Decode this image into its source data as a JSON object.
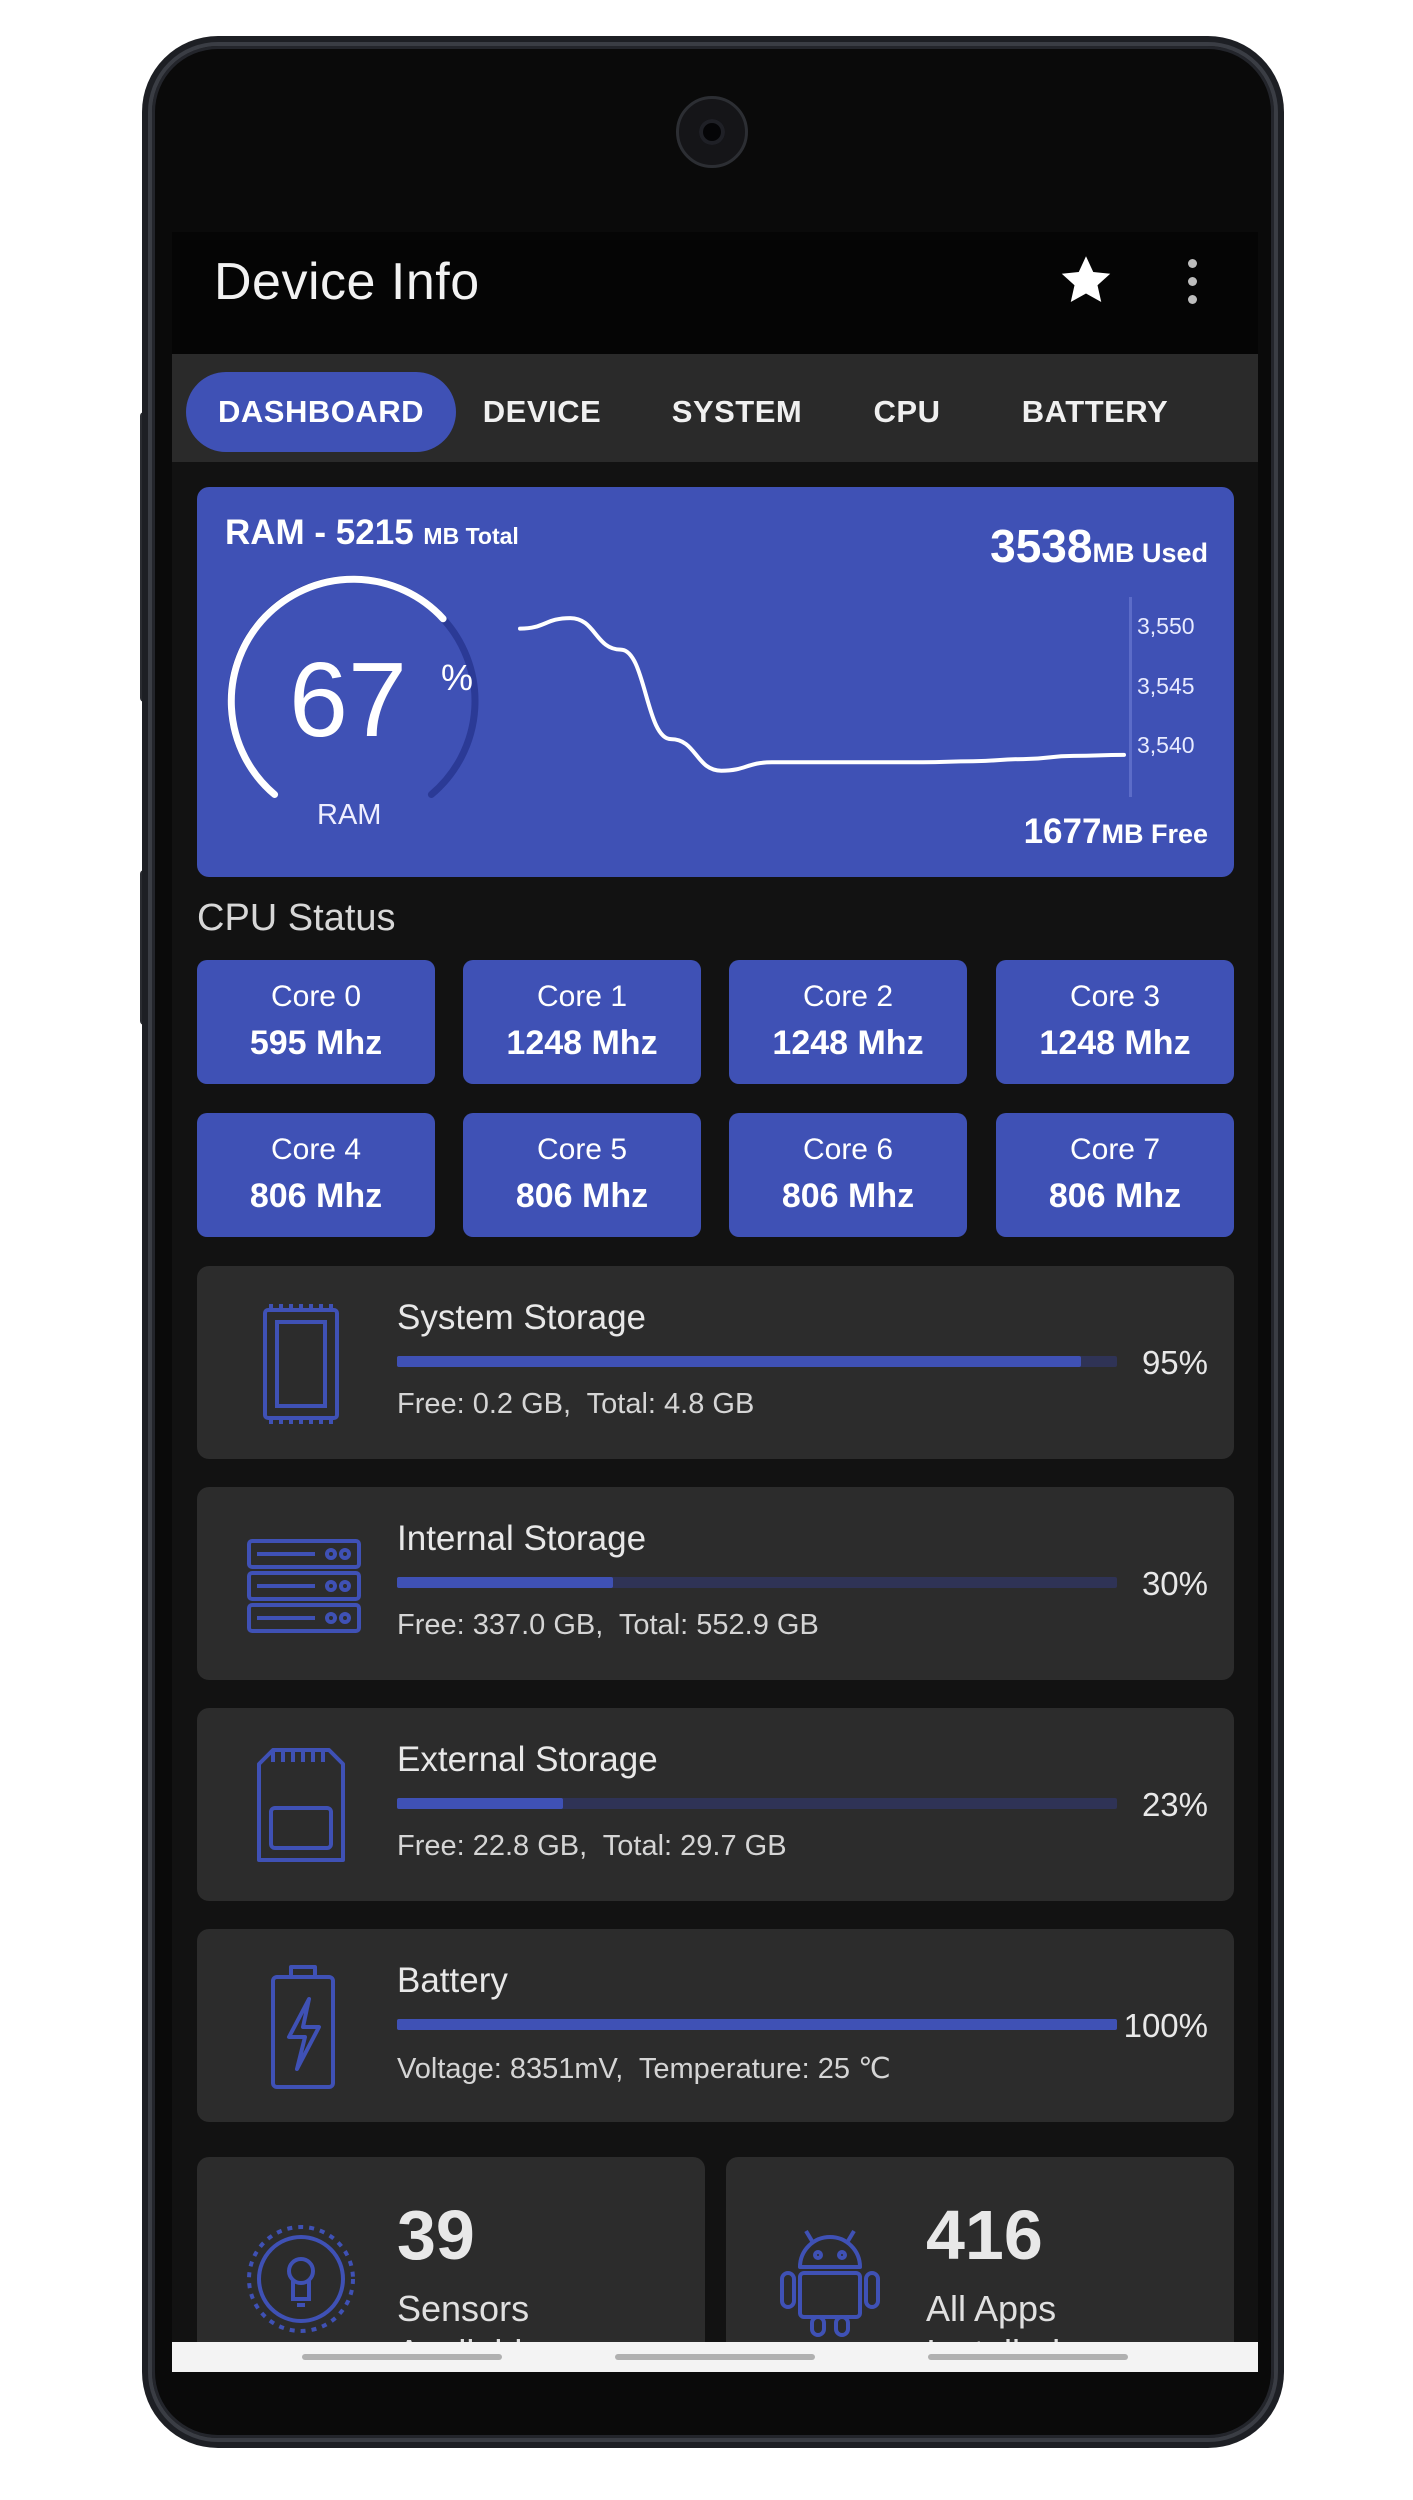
{
  "app": {
    "title": "Device Info"
  },
  "toolbar": {
    "favorite_icon": "star-icon",
    "menu_icon": "more-vert-icon"
  },
  "tabs": [
    {
      "label": "DASHBOARD",
      "active": true
    },
    {
      "label": "DEVICE",
      "active": false
    },
    {
      "label": "SYSTEM",
      "active": false
    },
    {
      "label": "CPU",
      "active": false
    },
    {
      "label": "BATTERY",
      "active": false
    }
  ],
  "ram": {
    "title": "RAM - 5215",
    "total_unit": "MB Total",
    "used_value": "3538",
    "used_unit": "MB Used",
    "free_value": "1677",
    "free_unit": "MB Free",
    "percent": "67",
    "percent_sign": "%",
    "percent_fraction": 0.67,
    "gauge_label": "RAM",
    "axis_ticks": [
      "3,550",
      "3,545",
      "3,540"
    ],
    "accent_color": "#3f51b5"
  },
  "chart_data": {
    "type": "line",
    "title": "",
    "xlabel": "",
    "ylabel": "",
    "y_ticks": [
      3540,
      3545,
      3550
    ],
    "ylim": [
      3533,
      3552
    ],
    "x": [
      0,
      1,
      2,
      3,
      4,
      5,
      6,
      7,
      8,
      9,
      10,
      11,
      12
    ],
    "series": [
      {
        "values": [
          3549,
          3550,
          3547,
          3538.5,
          3535.5,
          3536.3,
          3536.3,
          3536.3,
          3536.3,
          3536.4,
          3536.6,
          3536.9,
          3537
        ]
      }
    ]
  },
  "cpu": {
    "section_title": "CPU Status",
    "cores": [
      {
        "name": "Core 0",
        "freq": "595 Mhz"
      },
      {
        "name": "Core 1",
        "freq": "1248 Mhz"
      },
      {
        "name": "Core 2",
        "freq": "1248 Mhz"
      },
      {
        "name": "Core 3",
        "freq": "1248 Mhz"
      },
      {
        "name": "Core 4",
        "freq": "806 Mhz"
      },
      {
        "name": "Core 5",
        "freq": "806 Mhz"
      },
      {
        "name": "Core 6",
        "freq": "806 Mhz"
      },
      {
        "name": "Core 7",
        "freq": "806 Mhz"
      }
    ]
  },
  "storage": [
    {
      "name": "System Storage",
      "percent_label": "95%",
      "fraction": 0.95,
      "detail": "Free: 0.2 GB,  Total: 4.8 GB",
      "icon": "memory-chip-icon"
    },
    {
      "name": "Internal Storage",
      "percent_label": "30%",
      "fraction": 0.3,
      "detail": "Free: 337.0 GB,  Total: 552.9 GB",
      "icon": "server-icon"
    },
    {
      "name": "External Storage",
      "percent_label": "23%",
      "fraction": 0.23,
      "detail": "Free: 22.8 GB,  Total: 29.7 GB",
      "icon": "sd-card-icon"
    },
    {
      "name": "Battery",
      "percent_label": "100%",
      "fraction": 1.0,
      "detail": "Voltage: 8351mV,  Temperature: 25 ℃",
      "icon": "battery-charging-icon"
    }
  ],
  "summary": {
    "sensors": {
      "count": "39",
      "label": "Sensors",
      "label2": "Available",
      "icon": "sensor-icon"
    },
    "apps": {
      "count": "416",
      "label": "All Apps",
      "label2": "Installed",
      "icon": "android-icon"
    }
  }
}
